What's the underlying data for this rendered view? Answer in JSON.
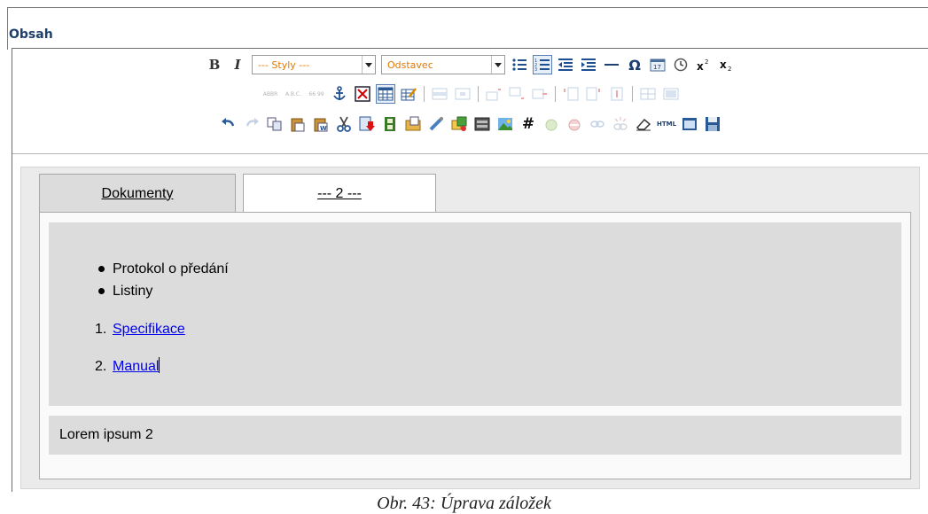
{
  "field_label": "Obsah",
  "toolbar": {
    "style_select": "--- Styly ---",
    "format_select": "Odstavec",
    "abbr_label": "ABBR",
    "acronym_label": "A.B.C.",
    "cite_label": "66 99",
    "hash_label": "#",
    "html_label": "HTML"
  },
  "tabs": [
    {
      "label": "Dokumenty",
      "active": true
    },
    {
      "label": "--- 2 ---",
      "active": false
    }
  ],
  "bullets": [
    "Protokol o předání",
    "Listiny"
  ],
  "numbered": [
    {
      "num": "1.",
      "label": "Specifikace"
    },
    {
      "num": "2.",
      "label": "Manual"
    }
  ],
  "footer_text": "Lorem ipsum 2",
  "caption": "Obr. 43: Úprava záložek",
  "colors": {
    "label": "#1f3f6b",
    "link": "#0000ee",
    "select_text": "#e07800"
  }
}
